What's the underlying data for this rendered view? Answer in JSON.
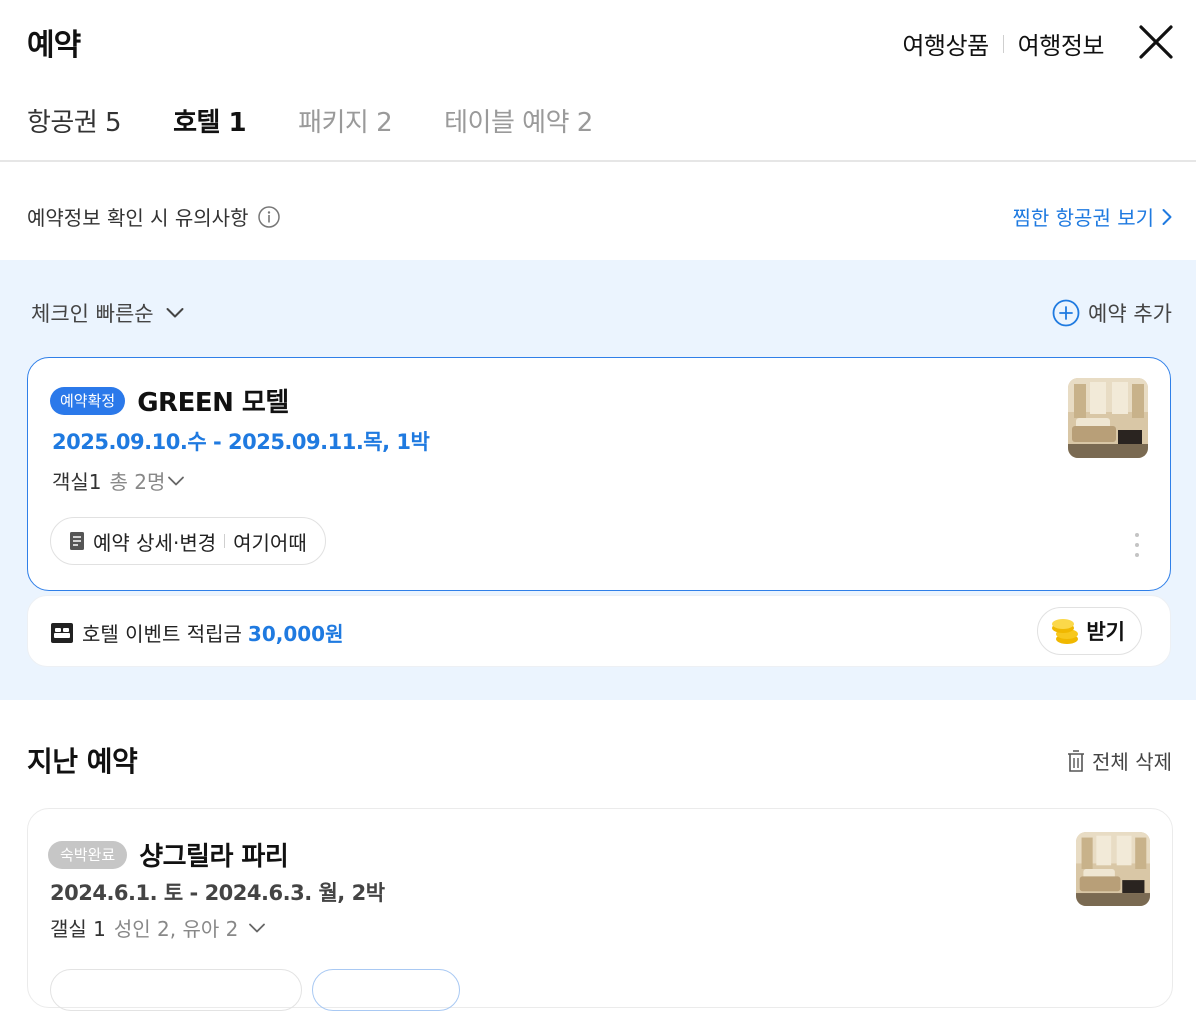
{
  "header": {
    "title": "예약",
    "links": [
      "여행상품",
      "여행정보"
    ],
    "close_icon": "close-icon"
  },
  "tabs": [
    {
      "label": "항공권 5",
      "state": "normal"
    },
    {
      "label": "호텔 1",
      "state": "active"
    },
    {
      "label": "패키지 2",
      "state": "muted"
    },
    {
      "label": "테이블 예약 2",
      "state": "muted"
    }
  ],
  "notice": {
    "text": "예약정보 확인 시 유의사항",
    "wishlist_link": "찜한 항공권 보기"
  },
  "current": {
    "sort_label": "체크인 빠른순",
    "add_label": "예약 추가",
    "reservation": {
      "status": "예약확정",
      "name": "GREEN 모텔",
      "dates": "2025.09.10.수 - 2025.09.11.목, 1박",
      "rooms": "객실1",
      "guests": "총 2명",
      "action_detail": "예약 상세·변경",
      "action_provider": "여기어때"
    },
    "event": {
      "text": "호텔 이벤트 적립금",
      "amount": "30,000원",
      "button": "받기"
    }
  },
  "past": {
    "title": "지난 예약",
    "delete_all": "전체 삭제",
    "reservation": {
      "status": "숙박완료",
      "name": "샹그릴라 파리",
      "dates": "2024.6.1. 토 - 2024.6.3. 월, 2박",
      "rooms": "갤실 1",
      "guests": "성인 2, 유아 2"
    }
  },
  "colors": {
    "accent": "#1f7ae0",
    "badge_confirmed": "#2b79ea",
    "badge_done": "#c6c6c6",
    "blue_background": "#ebf4fe"
  }
}
